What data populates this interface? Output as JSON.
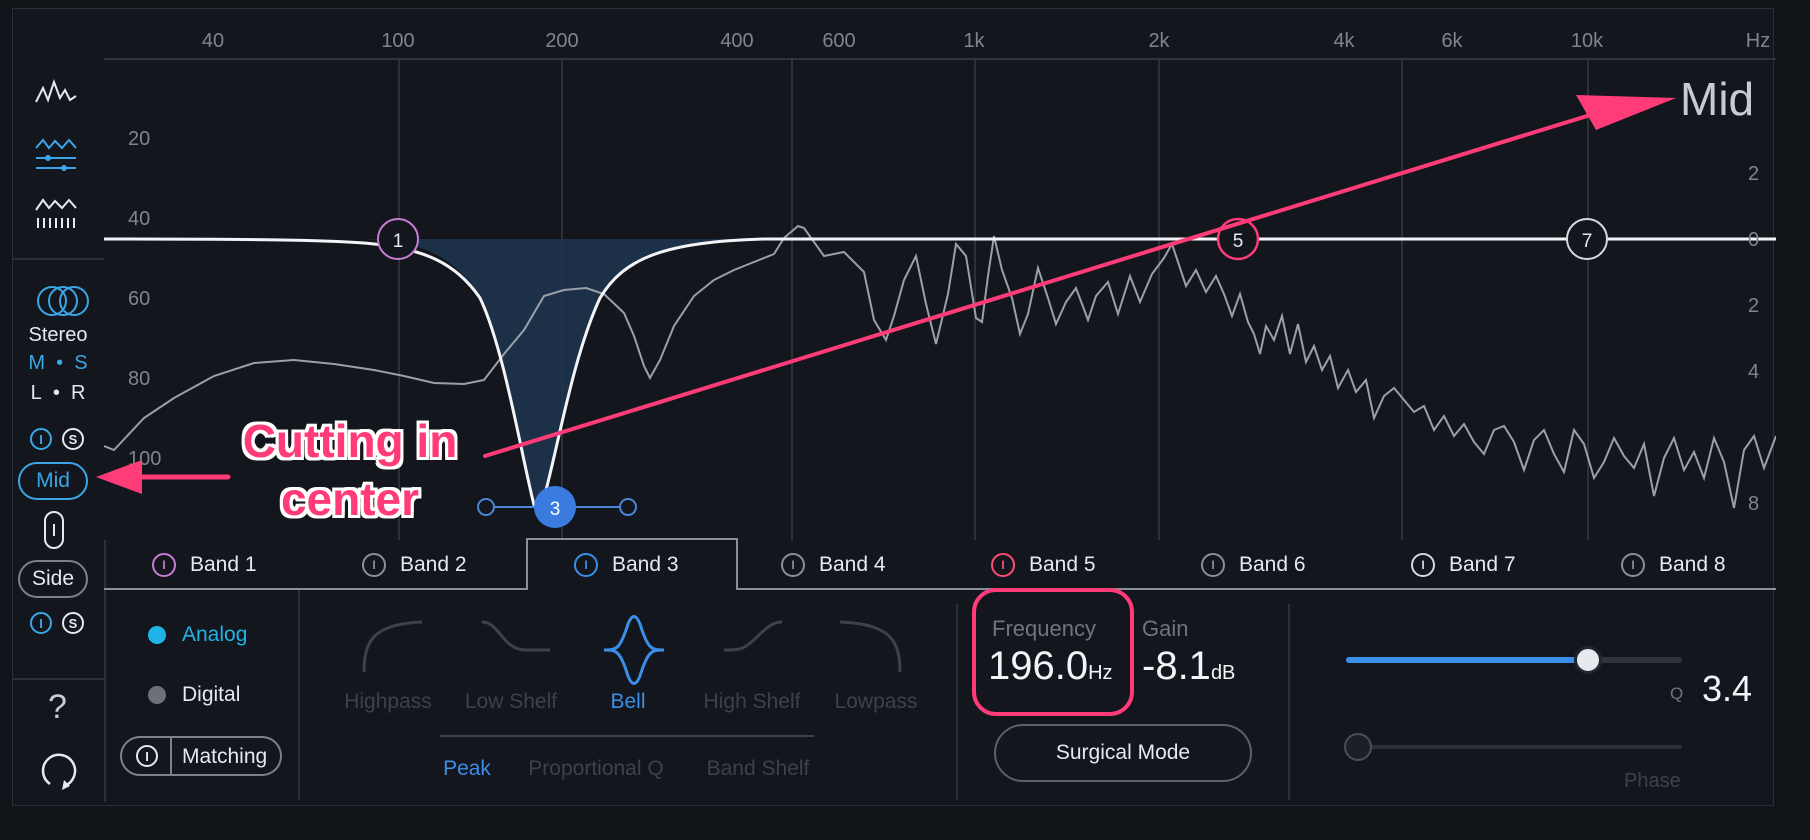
{
  "freq_axis": {
    "labels": [
      "40",
      "100",
      "200",
      "400",
      "600",
      "1k",
      "2k",
      "4k",
      "6k",
      "10k",
      "Hz"
    ]
  },
  "left_db_axis": {
    "labels": [
      "20",
      "40",
      "60",
      "80",
      "100"
    ]
  },
  "right_db_axis": {
    "labels": [
      "2",
      "0",
      "2",
      "4",
      "8"
    ]
  },
  "channel_label": "Mid",
  "sidebar": {
    "stereo_label": "Stereo",
    "ms_label": {
      "m": "M",
      "dot": "•",
      "s": "S"
    },
    "lr_label": {
      "l": "L",
      "dot": "•",
      "r": "R"
    },
    "mid_button": "Mid",
    "side_button": "Side",
    "help": "?",
    "solo_glyph": "S",
    "power_glyph": "I"
  },
  "nodes": [
    {
      "label": "1",
      "color": "#c77dd2"
    },
    {
      "label": "3",
      "color": "#3a7be0"
    },
    {
      "label": "5",
      "color": "#ff3b78"
    },
    {
      "label": "7",
      "color": "#d6d9de"
    }
  ],
  "tabs": [
    {
      "label": "Band 1",
      "color": "#c77dd2"
    },
    {
      "label": "Band 2",
      "color": "#8a8f98"
    },
    {
      "label": "Band 3",
      "color": "#3a8fe8"
    },
    {
      "label": "Band 4",
      "color": "#8a8f98"
    },
    {
      "label": "Band 5",
      "color": "#ff4b78"
    },
    {
      "label": "Band 6",
      "color": "#8a8f98"
    },
    {
      "label": "Band 7",
      "color": "#d6d9de"
    },
    {
      "label": "Band 8",
      "color": "#8a8f98"
    }
  ],
  "mode": {
    "analog": "Analog",
    "digital": "Digital",
    "matching": "Matching"
  },
  "shapes": [
    "Highpass",
    "Low Shelf",
    "Bell",
    "High Shelf",
    "Lowpass"
  ],
  "bell_modes": [
    "Peak",
    "Proportional Q",
    "Band Shelf"
  ],
  "frequency": {
    "label": "Frequency",
    "value": "196.0",
    "unit": "Hz"
  },
  "gain": {
    "label": "Gain",
    "value": "-8.1",
    "unit": "dB"
  },
  "surgical": "Surgical Mode",
  "q": {
    "label": "Q",
    "value": "3.4",
    "level": 0.72
  },
  "phase": {
    "label": "Phase",
    "level": 0.0
  },
  "annotation": {
    "line1": "Cutting in",
    "line2": "center"
  },
  "colors": {
    "accent": "#3a8fe8",
    "highlight": "#ff3b78",
    "analog": "#1fb3e8"
  }
}
